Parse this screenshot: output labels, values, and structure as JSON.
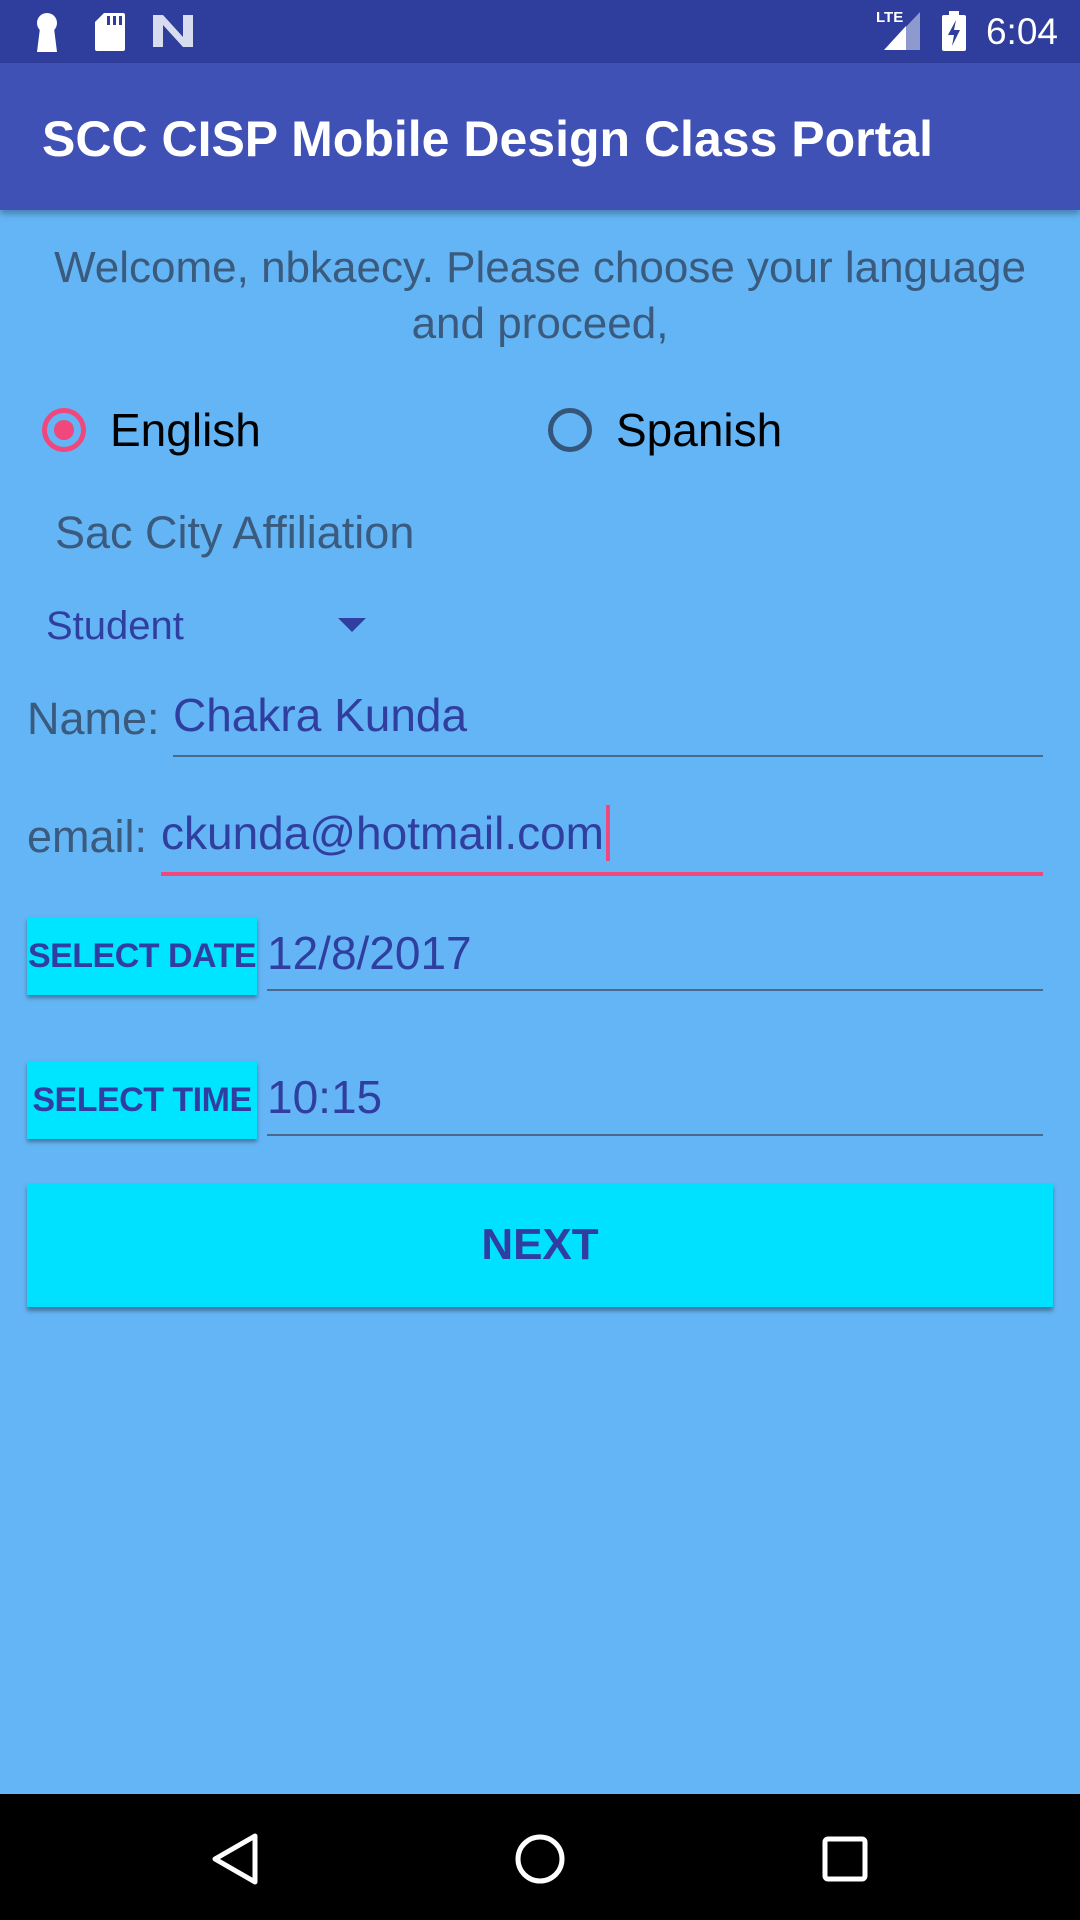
{
  "status_bar": {
    "time": "6:04",
    "network": "LTE",
    "left_icons": [
      "keyhole-icon",
      "sd-card-icon",
      "n-logo-icon"
    ],
    "right_icons": [
      "lte-signal-icon",
      "battery-charging-icon"
    ]
  },
  "app_bar": {
    "title": "SCC CISP Mobile Design Class Portal"
  },
  "welcome_text": "Welcome, nbkaecy. Please choose your language and proceed,",
  "language": {
    "options": [
      {
        "label": "English",
        "checked": true
      },
      {
        "label": "Spanish",
        "checked": false
      }
    ]
  },
  "affiliation": {
    "label": "Sac City Affiliation",
    "selected": "Student"
  },
  "form": {
    "name_label": "Name:",
    "name_value": "Chakra Kunda",
    "email_label": "email:",
    "email_value": "ckunda@hotmail.com",
    "select_date_label": "SELECT DATE",
    "date_value": "12/8/2017",
    "select_time_label": "SELECT TIME",
    "time_value": "10:15",
    "next_label": "NEXT"
  },
  "nav_bar": {
    "icons": [
      "back-icon",
      "home-icon",
      "recents-icon"
    ]
  },
  "colors": {
    "status_bar": "#2f3d9c",
    "app_bar": "#3f51b5",
    "background": "#64b5f5",
    "accent": "#f0477c",
    "button": "#00e5ff",
    "primary_text": "#303f9f"
  }
}
